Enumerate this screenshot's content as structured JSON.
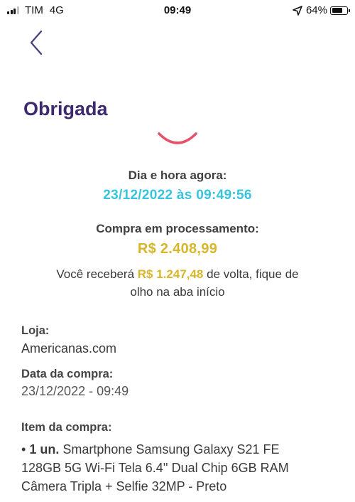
{
  "status_bar": {
    "carrier": "TIM",
    "network": "4G",
    "time": "09:49",
    "battery": "64%"
  },
  "header": {
    "back_icon": "chevron-left-icon",
    "title": "Obrigada"
  },
  "order": {
    "datetime_label": "Dia e hora agora:",
    "datetime_value": "23/12/2022 às 09:49:56",
    "status_label": "Compra em processamento:",
    "amount": "R$ 2.408,99",
    "cashback_prefix": "Você receberá ",
    "cashback_amount": "R$ 1.247,48",
    "cashback_line1_suffix": " de volta, fique de",
    "cashback_line2": "olho na aba início"
  },
  "details": {
    "store_label": "Loja:",
    "store_value": "Americanas.com",
    "date_label": "Data da compra:",
    "date_value": "23/12/2022 - 09:49",
    "item_label": "Item da compra:",
    "item_bullet": "• ",
    "item_qty": "1 un.",
    "item_line1": " Smartphone Samsung Galaxy S21 FE",
    "item_line2": "128GB 5G Wi-Fi Tela 6.4'' Dual Chip 6GB RAM",
    "item_line3": "Câmera Tripla + Selfie 32MP - Preto"
  },
  "colors": {
    "title": "#3d2a6e",
    "datetime": "#36c4e0",
    "amount": "#d8b62c",
    "spinner": "#e8506a"
  }
}
